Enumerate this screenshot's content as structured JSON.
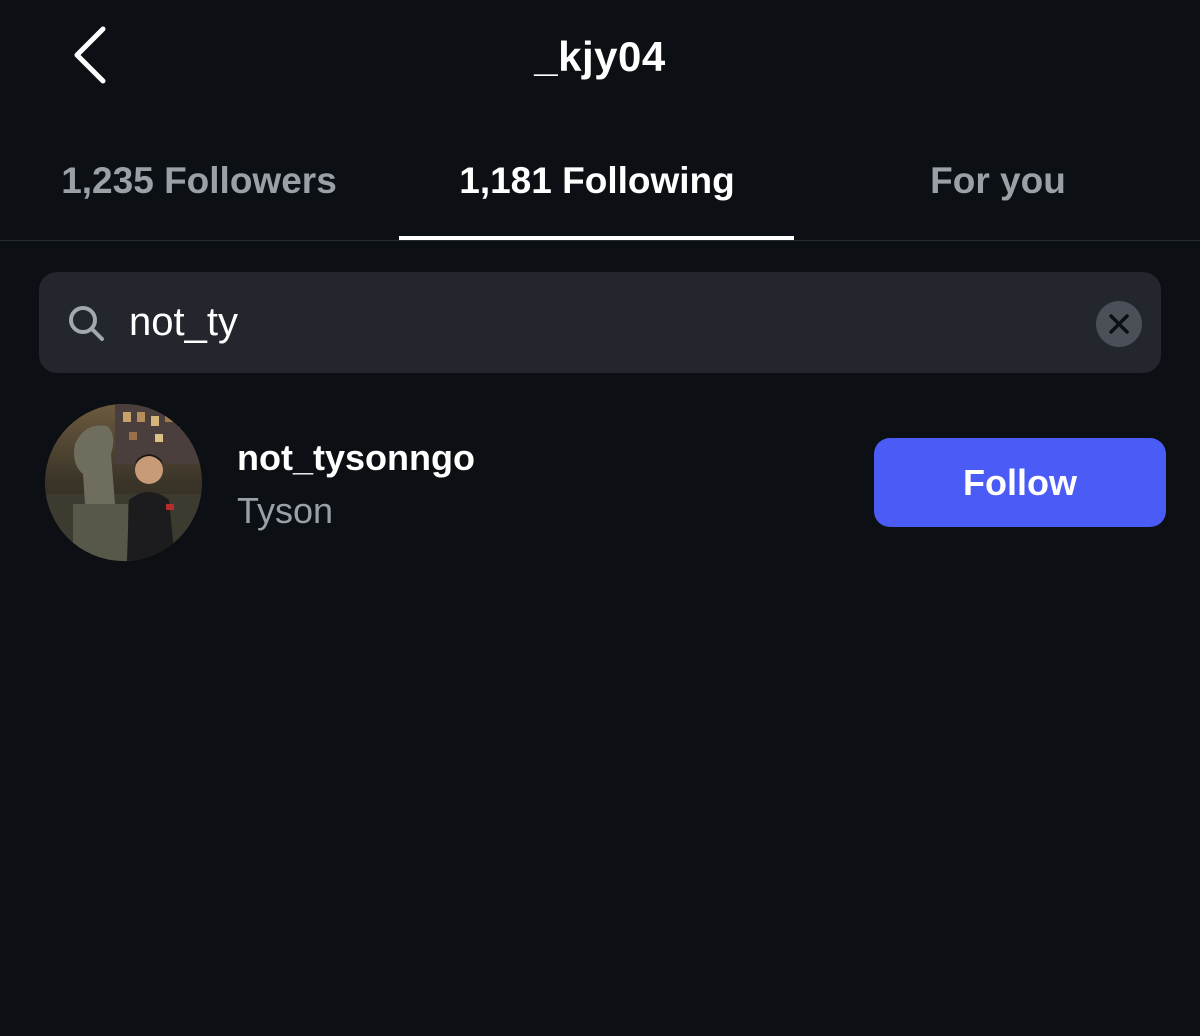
{
  "header": {
    "title": "_kjy04",
    "back_icon": "chevron-left-icon"
  },
  "tabs": [
    {
      "label": "1,235 Followers",
      "active": false
    },
    {
      "label": "1,181 Following",
      "active": true
    },
    {
      "label": "For you",
      "active": false
    }
  ],
  "search": {
    "value": "not_ty",
    "icon": "search-icon",
    "clear_icon": "close-icon"
  },
  "results": [
    {
      "username": "not_tysonngo",
      "full_name": "Tyson",
      "avatar": "avatar-photo",
      "follow_label": "Follow"
    }
  ],
  "colors": {
    "background": "#0c0f14",
    "search_bg": "#23262d",
    "follow_button": "#4a5cf5",
    "muted_text": "#9aa0a8"
  }
}
